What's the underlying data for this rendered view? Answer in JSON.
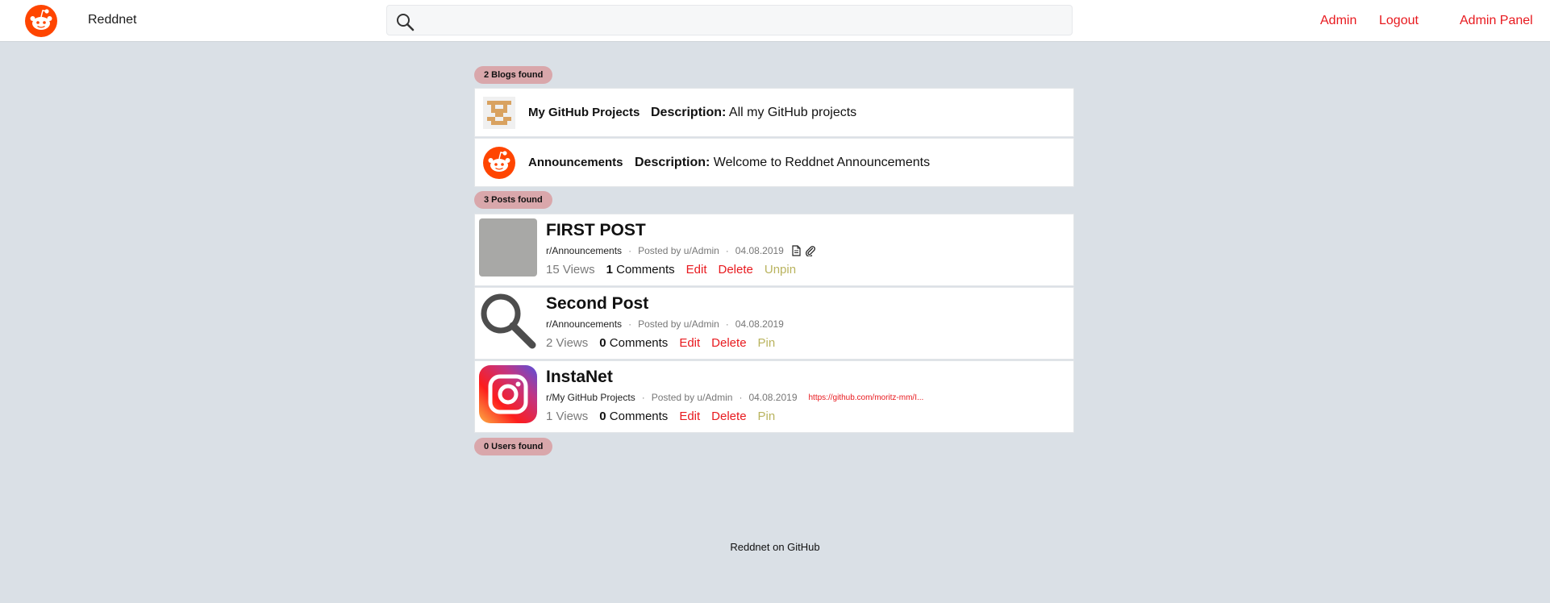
{
  "header": {
    "brand": "Reddnet",
    "search": {
      "value": "",
      "placeholder": ""
    },
    "nav": {
      "admin": "Admin",
      "logout": "Logout",
      "admin_panel": "Admin Panel"
    }
  },
  "blogs": {
    "found_label": "2 Blogs found",
    "items": [
      {
        "name": "My GitHub Projects",
        "desc_label": "Description:",
        "desc": "All my GitHub projects",
        "icon": "pixel-avatar-icon"
      },
      {
        "name": "Announcements",
        "desc_label": "Description:",
        "desc": "Welcome to Reddnet Announcements",
        "icon": "reddnet-logo-icon"
      }
    ]
  },
  "posts": {
    "found_label": "3 Posts found",
    "items": [
      {
        "title": "FIRST POST",
        "sub": "r/Announcements",
        "posted_by": "Posted by u/Admin",
        "date": "04.08.2019",
        "views": "15 Views",
        "comment_count": "1",
        "comments_label": "Comments",
        "edit": "Edit",
        "delete": "Delete",
        "pin": "Unpin",
        "thumb": "gray-placeholder"
      },
      {
        "title": "Second Post",
        "sub": "r/Announcements",
        "posted_by": "Posted by u/Admin",
        "date": "04.08.2019",
        "views": "2 Views",
        "comment_count": "0",
        "comments_label": "Comments",
        "edit": "Edit",
        "delete": "Delete",
        "pin": "Pin",
        "thumb": "magnifier-icon"
      },
      {
        "title": "InstaNet",
        "sub": "r/My GitHub Projects",
        "posted_by": "Posted by u/Admin",
        "date": "04.08.2019",
        "url": "https://github.com/moritz-mm/I...",
        "views": "1 Views",
        "comment_count": "0",
        "comments_label": "Comments",
        "edit": "Edit",
        "delete": "Delete",
        "pin": "Pin",
        "thumb": "instagram-logo-icon"
      }
    ]
  },
  "users": {
    "found_label": "0 Users found"
  },
  "footer": {
    "link": "Reddnet on GitHub"
  },
  "colors": {
    "accent": "#e8191e",
    "badge": "#d9a7ab",
    "pin": "#b9b35e",
    "background": "#dae0e6"
  }
}
